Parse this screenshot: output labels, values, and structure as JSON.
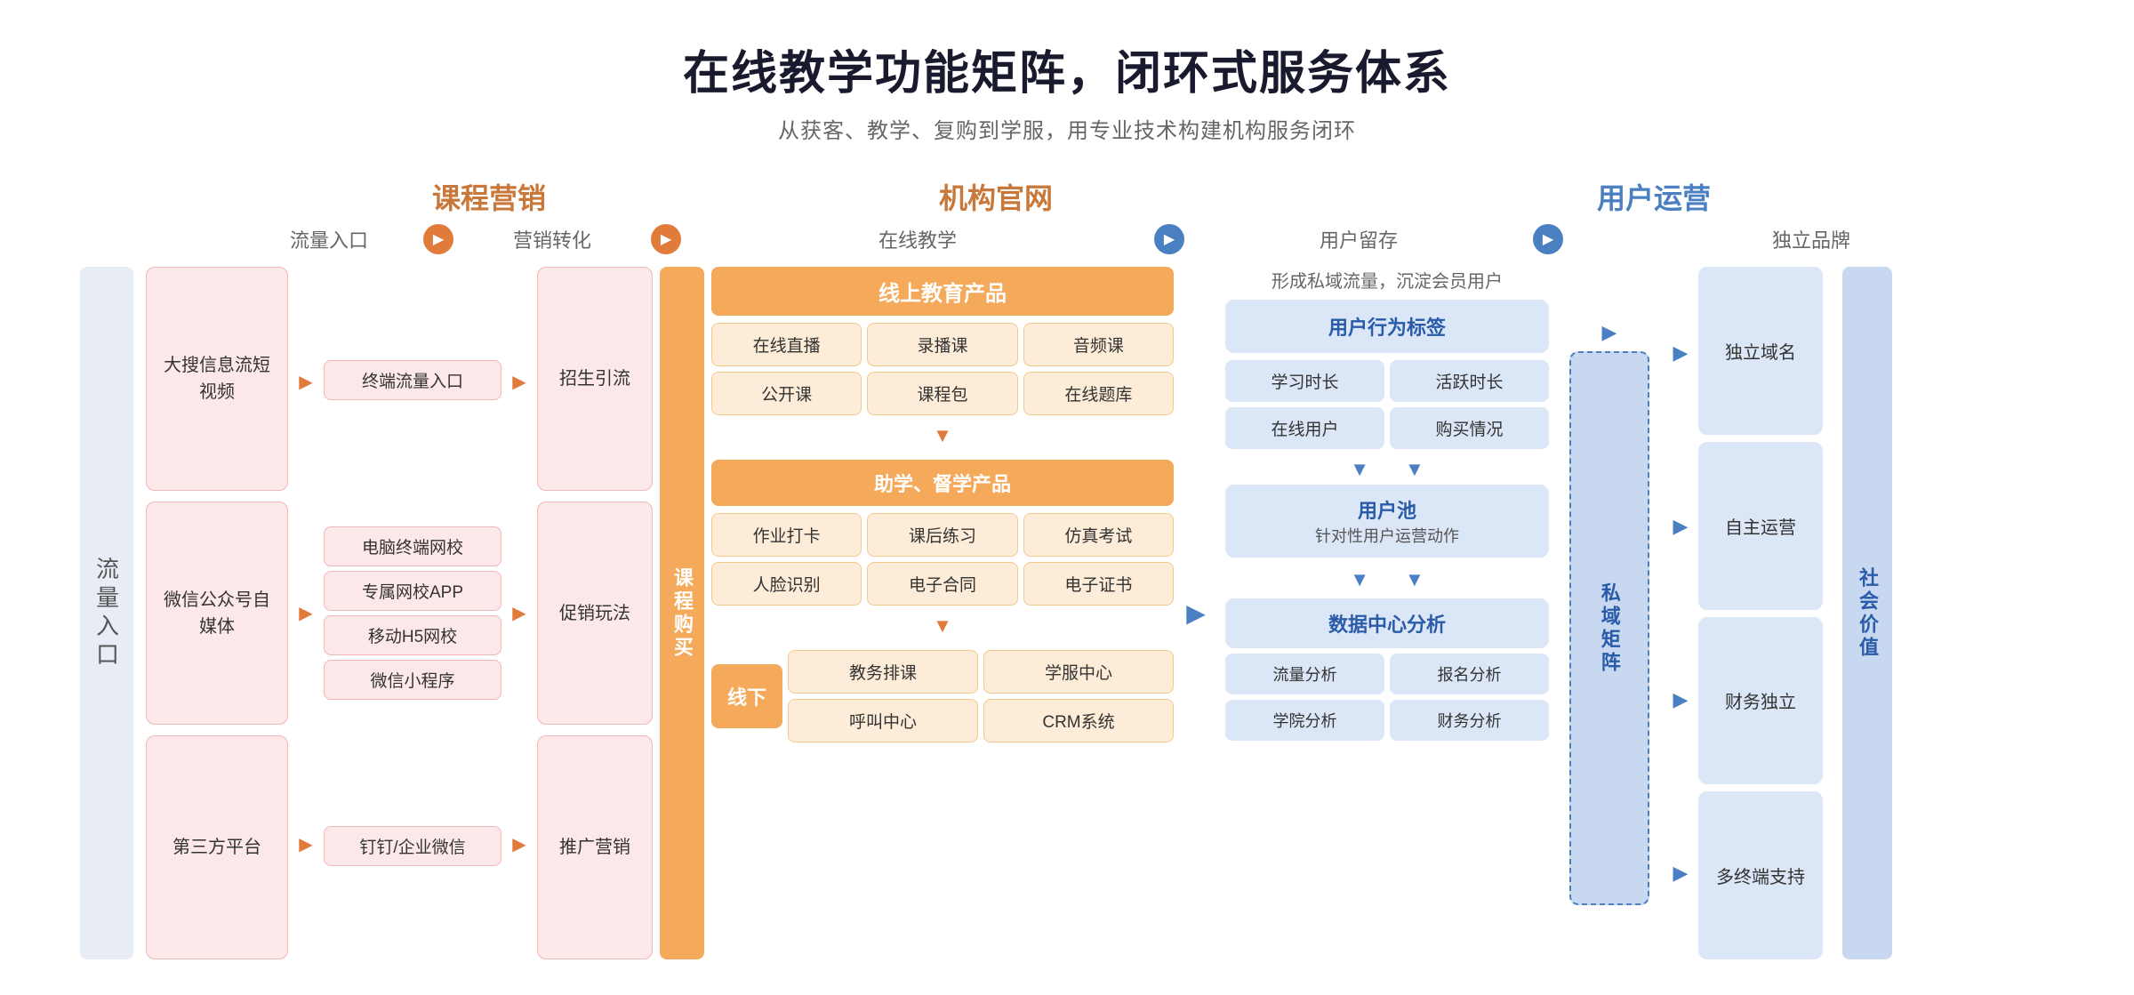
{
  "page": {
    "title": "在线教学功能矩阵，闭环式服务体系",
    "subtitle": "从获客、教学、复购到学服，用专业技术构建机构服务闭环"
  },
  "sections": {
    "marketing": "课程营销",
    "website": "机构官网",
    "operation": "用户运营"
  },
  "steps": {
    "traffic_entry": "流量入口",
    "marketing_conversion": "营销转化",
    "online_teaching": "在线教学",
    "user_retention": "用户留存",
    "independent_brand": "独立品牌"
  },
  "left_label": "流量入口",
  "traffic_sources": [
    "大搜信息流短视频",
    "微信公众号自媒体",
    "第三方平台"
  ],
  "terminal_entries": {
    "group1": [
      "终端流量入口"
    ],
    "group2": [
      "电脑终端网校",
      "专属网校APP",
      "移动H5网校",
      "微信小程序"
    ],
    "group3": [
      "钉钉/企业微信"
    ]
  },
  "marketing_items": [
    "招生引流",
    "促销玩法",
    "推广营销"
  ],
  "course_purchase": "课程购买",
  "online_education": {
    "title": "线上教育产品",
    "items": [
      "在线直播",
      "录播课",
      "音频课",
      "公开课",
      "课程包",
      "在线题库"
    ],
    "aid_title": "助学、督学产品",
    "aid_items": [
      "作业打卡",
      "课后练习",
      "仿真考试",
      "人脸识别",
      "电子合同",
      "电子证书"
    ],
    "offline_label": "线下",
    "offline_items": [
      "教务排课",
      "学服中心",
      "呼叫中心",
      "CRM系统"
    ]
  },
  "user_retention": {
    "desc": "形成私域流量，沉淀会员用户",
    "behavior_tag_title": "用户行为标签",
    "tags": [
      "学习时长",
      "活跃时长",
      "在线用户",
      "购买情况"
    ],
    "user_pool": "用户池",
    "user_pool_sub": "针对性用户运营动作",
    "data_center": "数据中心分析",
    "data_items": [
      "流量分析",
      "报名分析",
      "学院分析",
      "财务分析"
    ]
  },
  "private_domain": "私域矩阵",
  "brand_items": [
    "独立域名",
    "自主运营",
    "财务独立",
    "多终端支持"
  ],
  "social_value": "社会价值"
}
